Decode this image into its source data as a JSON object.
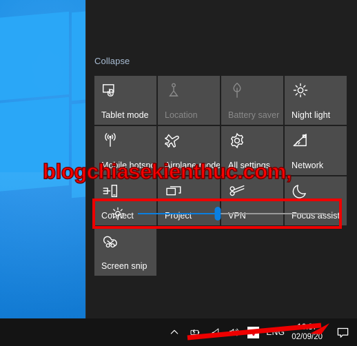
{
  "desktop": {
    "wallpaper_name": "windows-10-default-wallpaper",
    "background_color": "#0f7ad6",
    "logo_color": "#2aa8f7"
  },
  "action_center": {
    "background_color": "#1f1f1f",
    "collapse_label": "Collapse",
    "collapse_color": "#a9bdd4",
    "tiles": [
      {
        "label": "Tablet mode",
        "icon": "tablet-mode-icon",
        "state": "enabled"
      },
      {
        "label": "Location",
        "icon": "location-icon",
        "state": "disabled"
      },
      {
        "label": "Battery saver",
        "icon": "battery-saver-icon",
        "state": "disabled"
      },
      {
        "label": "Night light",
        "icon": "night-light-icon",
        "state": "enabled"
      },
      {
        "label": "Mobile hotspot",
        "icon": "mobile-hotspot-icon",
        "state": "enabled"
      },
      {
        "label": "Airplane mode",
        "icon": "airplane-mode-icon",
        "state": "enabled"
      },
      {
        "label": "All settings",
        "icon": "gear-icon",
        "state": "enabled"
      },
      {
        "label": "Network",
        "icon": "network-wifi-icon",
        "state": "enabled"
      },
      {
        "label": "Connect",
        "icon": "connect-icon",
        "state": "enabled"
      },
      {
        "label": "Project",
        "icon": "project-icon",
        "state": "enabled"
      },
      {
        "label": "VPN",
        "icon": "vpn-key-icon",
        "state": "enabled"
      },
      {
        "label": "Focus assist",
        "icon": "moon-icon",
        "state": "enabled"
      },
      {
        "label": "Screen snip",
        "icon": "screen-snip-icon",
        "state": "enabled"
      }
    ],
    "brightness": {
      "icon": "brightness-sun-icon",
      "value_percent": 43,
      "fill_color": "#0a7fe0",
      "track_color": "#9b9b9b",
      "highlight_color": "#ee0000"
    }
  },
  "watermark": {
    "text": "blogchiasekienthuc.com,",
    "color": "#ff0000"
  },
  "taskbar": {
    "background_color": "#141414",
    "tray_icons": [
      {
        "name": "show-hidden-icons-chevron"
      },
      {
        "name": "battery-charging-icon"
      },
      {
        "name": "wifi-icon"
      },
      {
        "name": "volume-icon"
      }
    ],
    "vn_badge_label": "V",
    "language_label": "ENG",
    "clock": {
      "time": "16:37",
      "date": "02/09/20"
    },
    "action_center_icon": "action-center-speech-bubble-icon"
  }
}
